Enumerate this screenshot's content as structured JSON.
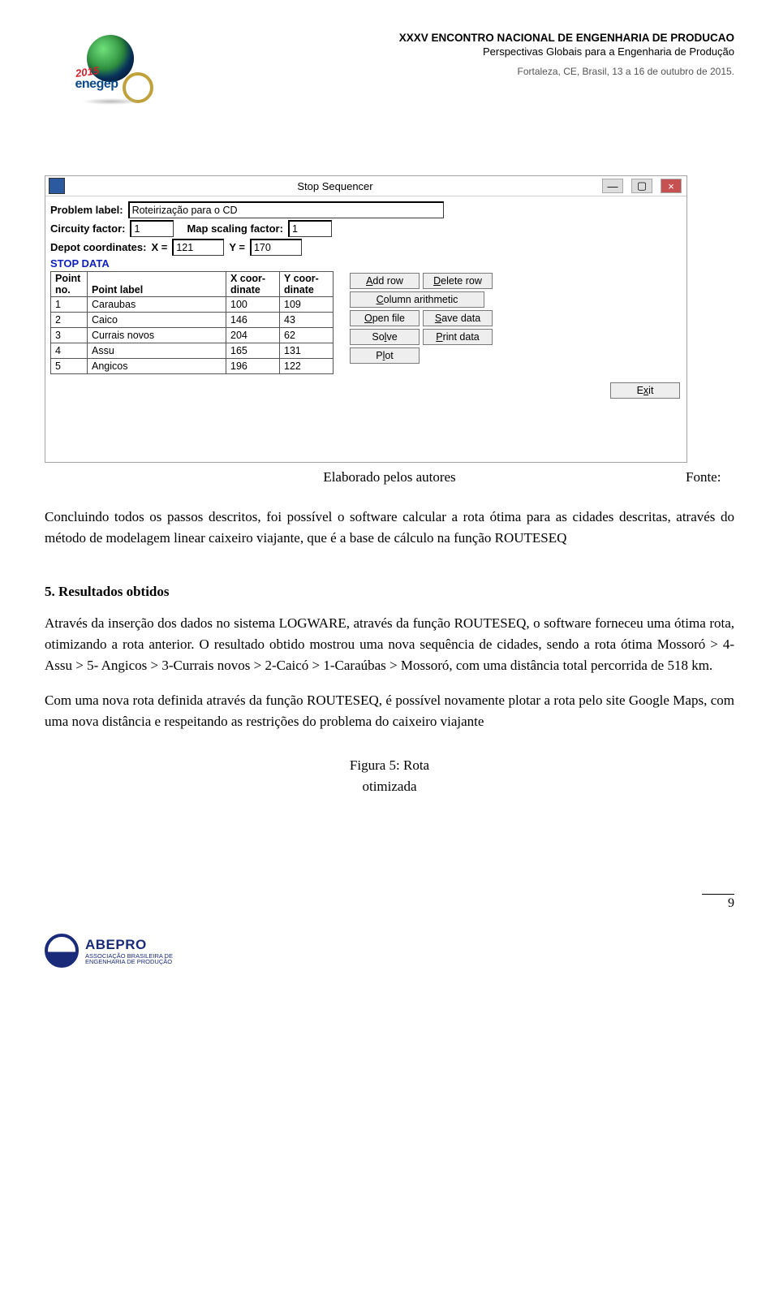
{
  "header": {
    "line1": "XXXV ENCONTRO NACIONAL DE ENGENHARIA DE PRODUCAO",
    "line2": "Perspectivas Globais para a Engenharia de Produção",
    "line3": "Fortaleza, CE, Brasil, 13 a 16 de outubro de 2015.",
    "logo_year": "2015",
    "logo_brand": "enegep"
  },
  "screenshot": {
    "title": "Stop Sequencer",
    "labels": {
      "problem_label": "Problem label:",
      "circuity": "Circuity factor:",
      "map_scale": "Map scaling factor:",
      "depot": "Depot coordinates:",
      "X": "X =",
      "Y": "Y =",
      "stop_data": "STOP DATA"
    },
    "values": {
      "problem_label": "Roteirização para o CD",
      "circuity": "1",
      "map_scale": "1",
      "depot_x": "121",
      "depot_y": "170"
    },
    "table": {
      "headers": {
        "no": "Point no.",
        "label": "Point label",
        "x": "X coor-dinate",
        "y": "Y coor-dinate"
      },
      "rows": [
        {
          "no": "1",
          "label": "Caraubas",
          "x": "100",
          "y": "109"
        },
        {
          "no": "2",
          "label": "Caico",
          "x": "146",
          "y": "43"
        },
        {
          "no": "3",
          "label": "Currais novos",
          "x": "204",
          "y": "62"
        },
        {
          "no": "4",
          "label": "Assu",
          "x": "165",
          "y": "131"
        },
        {
          "no": "5",
          "label": "Angicos",
          "x": "196",
          "y": "122"
        }
      ]
    },
    "buttons": {
      "add_row": "Add row",
      "del_row": "Delete row",
      "col_arith": "Column arithmetic",
      "open": "Open file",
      "save": "Save data",
      "solve": "Solve",
      "print": "Print data",
      "plot": "Plot",
      "exit": "Exit"
    }
  },
  "source": {
    "left": "Elaborado pelos autores",
    "right": "Fonte:"
  },
  "body": {
    "p1": "Concluindo todos os passos descritos, foi possível o software calcular a rota ótima para as cidades descritas, através do método de modelagem linear caixeiro viajante, que é a base de cálculo na função ROUTESEQ",
    "h5": "5. Resultados obtidos",
    "p2": "Através da inserção dos dados no sistema LOGWARE, através da função ROUTESEQ, o software forneceu uma ótima rota, otimizando a rota anterior. O resultado obtido mostrou uma nova sequência de cidades, sendo a rota ótima Mossoró > 4- Assu > 5- Angicos > 3-Currais novos > 2-Caicó > 1-Caraúbas > Mossoró, com uma distância total percorrida de 518 km.",
    "p3": "Com uma nova rota definida através da função ROUTESEQ, é possível novamente plotar a rota pelo site Google Maps, com uma nova distância e respeitando as restrições do problema do caixeiro viajante",
    "fig": "Figura 5: Rota otimizada"
  },
  "page_number": "9",
  "footer": {
    "brand": "ABEPRO",
    "line2a": "ASSOCIAÇÃO BRASILEIRA DE",
    "line2b": "ENGENHARIA DE PRODUÇÃO"
  }
}
